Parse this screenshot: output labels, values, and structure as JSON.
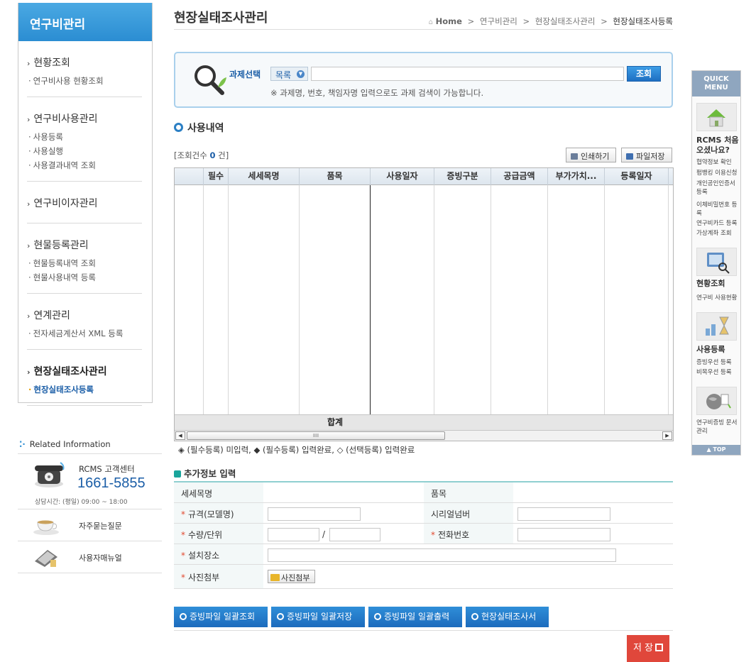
{
  "sidebar": {
    "title": "연구비관리",
    "groups": [
      {
        "label": "현황조회",
        "items": [
          "연구비사용 현황조회"
        ]
      },
      {
        "label": "연구비사용관리",
        "items": [
          "사용등록",
          "사용실행",
          "사용결과내역 조회"
        ]
      },
      {
        "label": "연구비이자관리",
        "items": []
      },
      {
        "label": "현물등록관리",
        "items": [
          "현물등록내역 조회",
          "현물사용내역 등록"
        ]
      },
      {
        "label": "연계관리",
        "items": [
          "전자세금계산서 XML 등록"
        ]
      },
      {
        "label": "현장실태조사관리",
        "items": [
          "현장실태조사등록"
        ]
      }
    ],
    "active_group": "현장실태조사관리",
    "active_item": "현장실태조사등록"
  },
  "related": {
    "title": "Related Information",
    "callcenter_name": "RCMS 고객센터",
    "callcenter_number": "1661-5855",
    "callcenter_hours": "상담시간: (평일) 09:00 ~ 18:00",
    "faq": "자주묻는질문",
    "manual": "사용자매뉴얼"
  },
  "header": {
    "title": "현장실태조사관리",
    "breadcrumb": [
      "Home",
      "연구비관리",
      "현장실태조사관리",
      "현장실태조사등록"
    ]
  },
  "search": {
    "label": "과제선택",
    "select_value": "목록",
    "input_value": "",
    "button": "조회",
    "hint": "※ 과제명, 번호, 책임자명 입력으로도 과제 검색이 가능합니다."
  },
  "usage": {
    "title": "사용내역",
    "count_prefix": "[조회건수",
    "count": "0",
    "count_suffix": "건]",
    "print_button": "인쇄하기",
    "save_button": "파일저장",
    "columns": [
      "",
      "필수",
      "세세목명",
      "품목",
      "사용일자",
      "증빙구분",
      "공급금액",
      "부가가치...",
      "등록일자"
    ],
    "sum_label": "합계",
    "scroll_thumb": "IIII",
    "legend": "◈ (필수등록) 미입력, ◆ (필수등록) 입력완료, ◇ (선택등록) 입력완료"
  },
  "extra": {
    "title": "추가정보 입력",
    "label_detail": "세세목명",
    "label_item": "품목",
    "label_spec": "규격(모델명)",
    "label_serial": "시리얼넘버",
    "label_qty": "수량/단위",
    "label_phone": "전화번호",
    "label_place": "설치장소",
    "label_photo": "사진첨부",
    "photo_button": "사진첨부",
    "required_mark": "*",
    "slash": "/"
  },
  "actions": {
    "btn1": "증빙파일 일괄조회",
    "btn2": "증빙파일 일괄저장",
    "btn3": "증빙파일 일괄출력",
    "btn4": "현장실태조사서",
    "save": "저 장"
  },
  "quick": {
    "title_line1": "QUICK",
    "title_line2": "MENU",
    "sec1_title": "RCMS 처음 오셨나요?",
    "sec1_links": [
      "협약정보 확인",
      "펌뱅킹 이용신청",
      "개인공인인증서 등록",
      "이체비밀번호 등록",
      "연구비카드 등록",
      "가상계좌 조회"
    ],
    "sec2_title": "현황조회",
    "sec2_links": [
      "연구비 사용현황"
    ],
    "sec3_title": "사용등록",
    "sec3_links": [
      "증빙우선 등록",
      "비목우선 등록"
    ],
    "sec4_links": [
      "연구비증빙 문서관리"
    ],
    "top": "▲ TOP"
  },
  "colors": {
    "accent": "#2b8dd2",
    "teal": "#1aa59c",
    "save": "#e0473b"
  }
}
